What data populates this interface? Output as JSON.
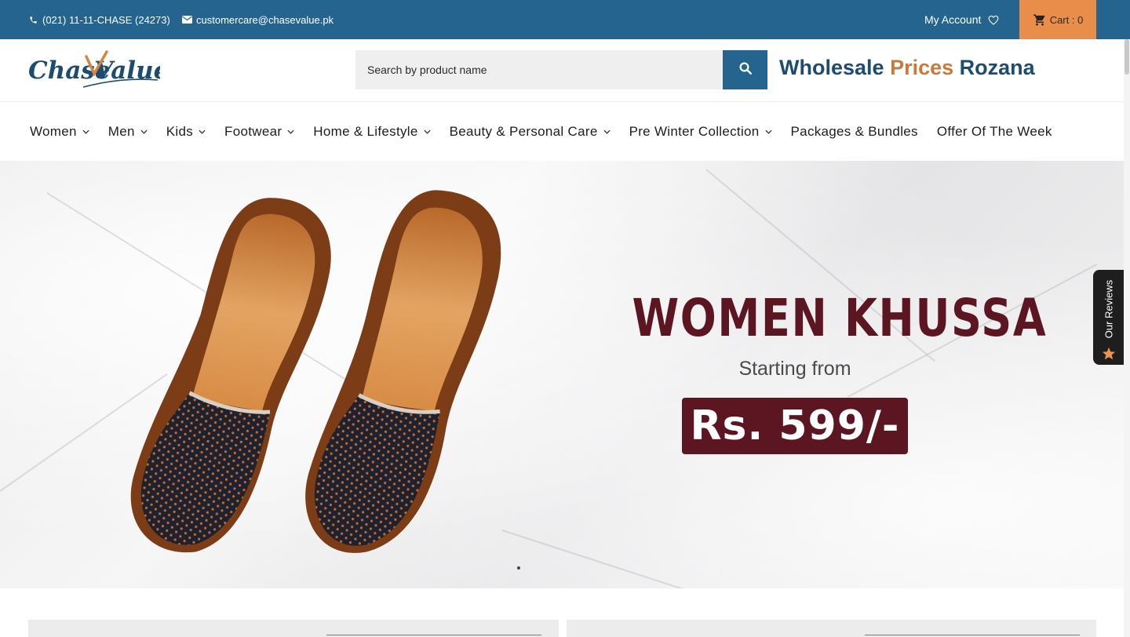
{
  "topbar": {
    "phone": "(021) 11-11-CHASE (24273)",
    "email": "customercare@chasevalue.pk",
    "account_label": "My Account",
    "cart_label": "Cart : 0",
    "colors": {
      "bar": "#24648f",
      "cart": "#e98d4a"
    }
  },
  "header": {
    "logo_text_1": "Chase",
    "logo_text_2": "Value",
    "search_placeholder": "Search by product name",
    "tagline_1": "Wholesale",
    "tagline_2": "Prices",
    "tagline_3": "Rozana"
  },
  "nav": {
    "items": [
      {
        "label": "Women",
        "has_dropdown": true
      },
      {
        "label": "Men",
        "has_dropdown": true
      },
      {
        "label": "Kids",
        "has_dropdown": true
      },
      {
        "label": "Footwear",
        "has_dropdown": true
      },
      {
        "label": "Home & Lifestyle",
        "has_dropdown": true
      },
      {
        "label": "Beauty & Personal Care",
        "has_dropdown": true
      },
      {
        "label": "Pre Winter Collection",
        "has_dropdown": true
      },
      {
        "label": "Packages & Bundles",
        "has_dropdown": false
      },
      {
        "label": "Offer Of The Week",
        "has_dropdown": false
      }
    ]
  },
  "hero": {
    "title": "WOMEN KHUSSA",
    "subtitle": "Starting from",
    "price": "Rs. 599/-",
    "colors": {
      "brand_maroon": "#5c1622"
    }
  },
  "reviews_tab": {
    "label": "Our Reviews"
  }
}
